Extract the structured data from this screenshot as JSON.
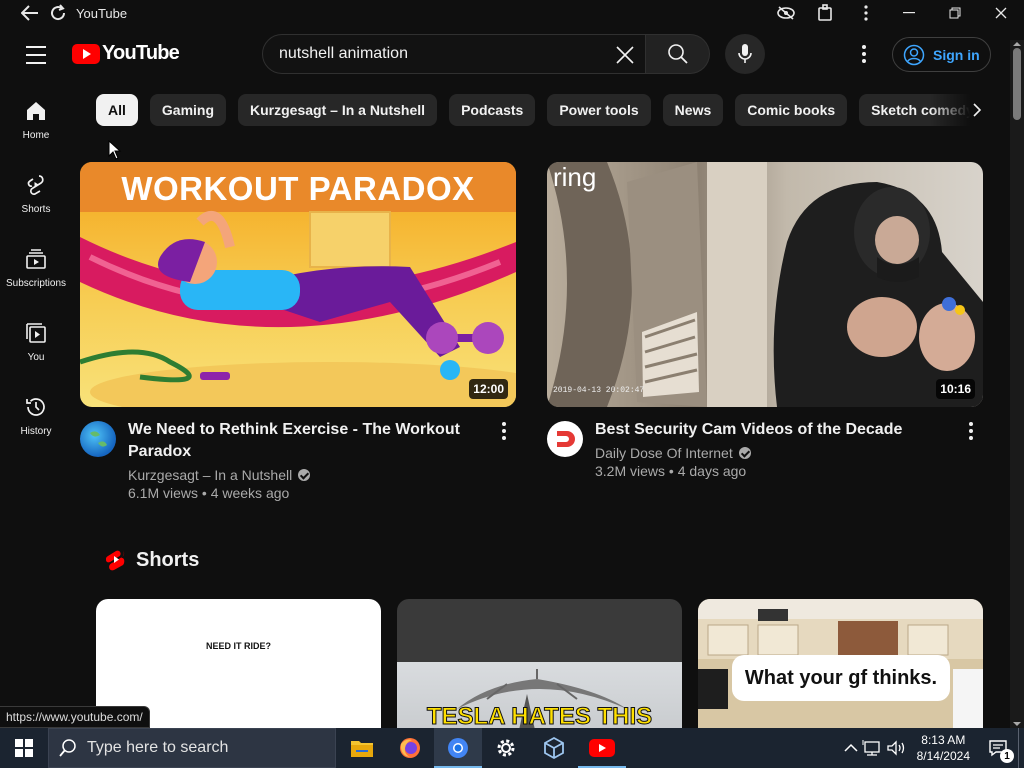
{
  "window": {
    "title": "YouTube"
  },
  "search": {
    "value": "nutshell animation",
    "placeholder": "Search"
  },
  "header": {
    "sign_in_label": "Sign in",
    "logo_text": "YouTube"
  },
  "guide": [
    {
      "label": "Home",
      "icon": "home-icon"
    },
    {
      "label": "Shorts",
      "icon": "shorts-icon"
    },
    {
      "label": "Subscriptions",
      "icon": "subscriptions-icon"
    },
    {
      "label": "You",
      "icon": "you-icon"
    },
    {
      "label": "History",
      "icon": "history-icon"
    }
  ],
  "chips": [
    "All",
    "Gaming",
    "Kurzgesagt – In a Nutshell",
    "Podcasts",
    "Power tools",
    "News",
    "Comic books",
    "Sketch comedy"
  ],
  "videos": [
    {
      "thumb_text": "WORKOUT PARADOX",
      "duration": "12:00",
      "title": "We Need to Rethink Exercise - The Workout Paradox",
      "channel": "Kurzgesagt – In a Nutshell",
      "stats": "6.1M views • 4 weeks ago"
    },
    {
      "thumb_text": "ring",
      "timestamp": "2019-04-13 20:02:47",
      "duration": "10:16",
      "title": "Best Security Cam Videos of the Decade",
      "channel": "Daily Dose Of Internet",
      "stats": "3.2M views • 4 days ago"
    }
  ],
  "shorts": {
    "heading": "Shorts",
    "items": [
      {
        "caption": "NEED IT RIDE?"
      },
      {
        "caption": "TESLA HATES THIS"
      },
      {
        "caption": "What your gf thinks."
      }
    ]
  },
  "status_url": "https://www.youtube.com/",
  "taskbar": {
    "search_placeholder": "Type here to search",
    "time": "8:13 AM",
    "date": "8/14/2024",
    "notification_count": "1"
  },
  "colors": {
    "brand": "#ff0000",
    "link": "#3ea6ff",
    "background": "#0f0f0f"
  }
}
